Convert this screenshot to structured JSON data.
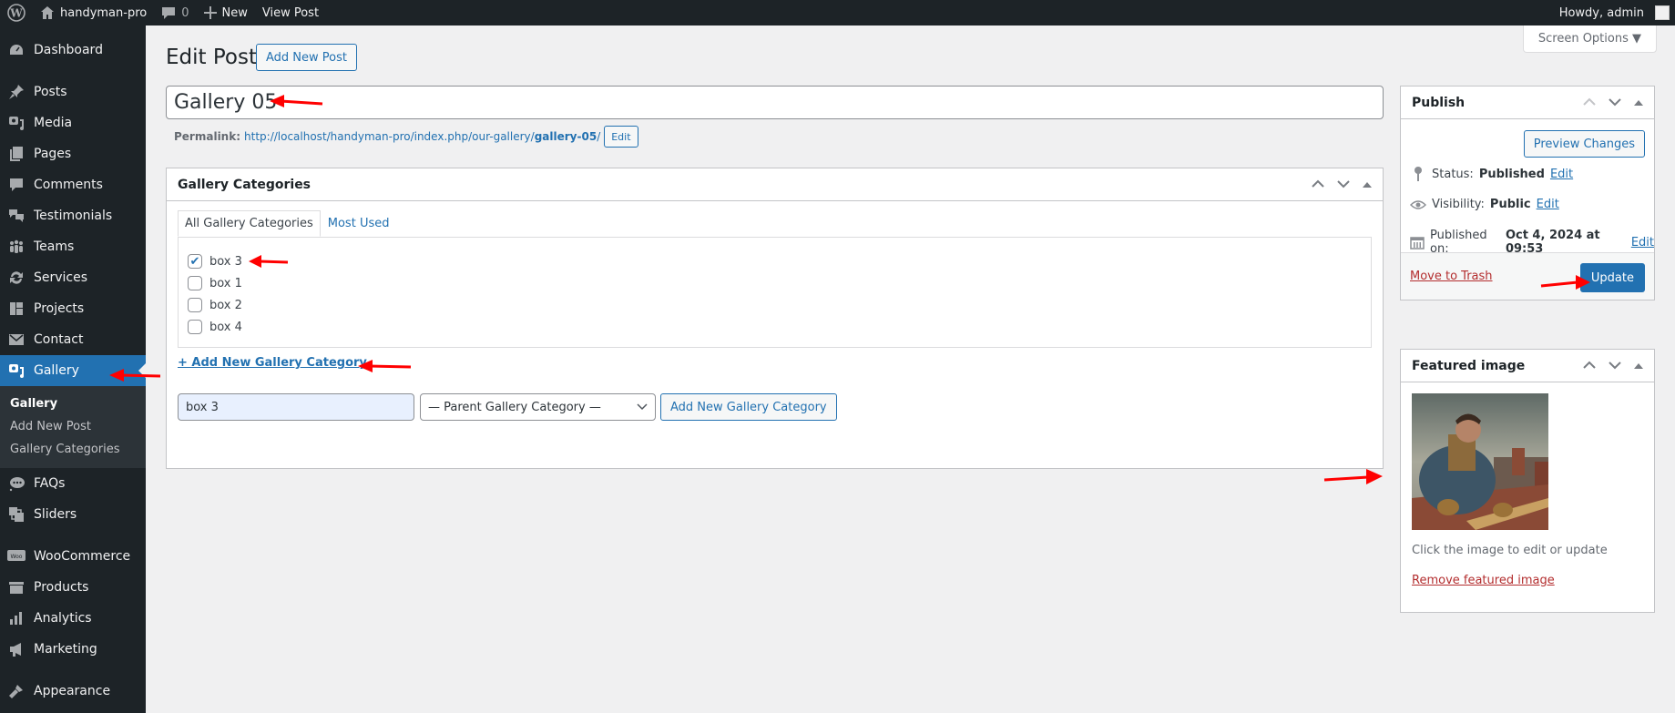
{
  "adminbar": {
    "site_name": "handyman-pro",
    "comments_count": "0",
    "new_label": "New",
    "view_post_label": "View Post",
    "greeting": "Howdy, admin"
  },
  "sidebar": {
    "items": [
      {
        "label": "Dashboard",
        "icon": "dashboard-icon"
      },
      {
        "label": "Posts",
        "icon": "pin-icon"
      },
      {
        "label": "Media",
        "icon": "media-icon"
      },
      {
        "label": "Pages",
        "icon": "pages-icon"
      },
      {
        "label": "Comments",
        "icon": "comment-icon"
      },
      {
        "label": "Testimonials",
        "icon": "testimonials-icon"
      },
      {
        "label": "Teams",
        "icon": "groups-icon"
      },
      {
        "label": "Services",
        "icon": "update-icon"
      },
      {
        "label": "Projects",
        "icon": "portfolio-icon"
      },
      {
        "label": "Contact",
        "icon": "email-icon"
      },
      {
        "label": "Gallery",
        "icon": "gallery-icon",
        "active": true
      },
      {
        "label": "FAQs",
        "icon": "faq-icon"
      },
      {
        "label": "Sliders",
        "icon": "slides-icon"
      },
      {
        "label": "WooCommerce",
        "icon": "woo-icon"
      },
      {
        "label": "Products",
        "icon": "archive-icon"
      },
      {
        "label": "Analytics",
        "icon": "chart-bar-icon"
      },
      {
        "label": "Marketing",
        "icon": "megaphone-icon"
      },
      {
        "label": "Appearance",
        "icon": "brush-icon"
      }
    ],
    "submenu": [
      {
        "label": "Gallery",
        "current": true
      },
      {
        "label": "Add New Post"
      },
      {
        "label": "Gallery Categories"
      }
    ]
  },
  "screen_options": "Screen Options ▼",
  "page": {
    "heading": "Edit Post",
    "add_new_label": "Add New Post",
    "title_value": "Gallery 05",
    "permalink_label": "Permalink:",
    "permalink_base": "http://localhost/handyman-pro/index.php/our-gallery/",
    "permalink_slug": "gallery-05",
    "permalink_end": "/",
    "permalink_edit": "Edit"
  },
  "gallery_categories": {
    "title": "Gallery Categories",
    "tabs": [
      "All Gallery Categories",
      "Most Used"
    ],
    "items": [
      {
        "label": "box 3",
        "checked": true
      },
      {
        "label": "box 1",
        "checked": false
      },
      {
        "label": "box 2",
        "checked": false
      },
      {
        "label": "box 4",
        "checked": false
      }
    ],
    "add_link": "+ Add New Gallery Category",
    "new_input_value": "box 3",
    "parent_select": "— Parent Gallery Category —",
    "add_button": "Add New Gallery Category"
  },
  "publish": {
    "title": "Publish",
    "preview_button": "Preview Changes",
    "status_label": "Status:",
    "status_value": "Published",
    "visibility_label": "Visibility:",
    "visibility_value": "Public",
    "published_label": "Published on:",
    "published_value": "Oct 4, 2024 at 09:53",
    "edit_label": "Edit",
    "trash_label": "Move to Trash",
    "update_button": "Update"
  },
  "featured_image": {
    "title": "Featured image",
    "caption": "Click the image to edit or update",
    "remove_label": "Remove featured image"
  },
  "annotation_color": "#ff0000"
}
